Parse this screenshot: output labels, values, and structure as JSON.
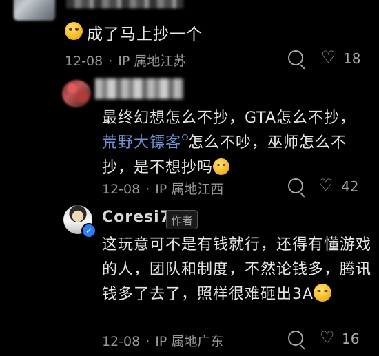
{
  "comments": [
    {
      "text": "成了马上抄一个",
      "emoji": "drool-face-emoji",
      "date": "12-08",
      "location": "IP 属地江苏",
      "likes": "18"
    },
    {
      "text_before": "最终幻想怎么不抄，GTA怎么不抄，",
      "link": "荒野大镖客",
      "text_after": "怎么不吵，巫师怎么不抄，是不想抄吗",
      "emoji": "grin-sweat-emoji",
      "date": "12-08",
      "location": "IP 属地江西",
      "likes": "42"
    },
    {
      "author": "Coresi7",
      "author_tag": "作者",
      "text": "这玩意可不是有钱就行，还得有懂游戏的人，团队和制度，不然论钱多，腾讯钱多了去了，照样很难砸出3A",
      "emoji": "rofl-emoji",
      "date": "12-08",
      "location": "IP 属地广东",
      "likes": "16"
    }
  ],
  "dot": "·",
  "colors": {
    "background": "#000000",
    "text": "#e6e6e6",
    "meta": "#9a9a9a",
    "link": "#6f93d6",
    "verified": "#2f7bf6"
  }
}
